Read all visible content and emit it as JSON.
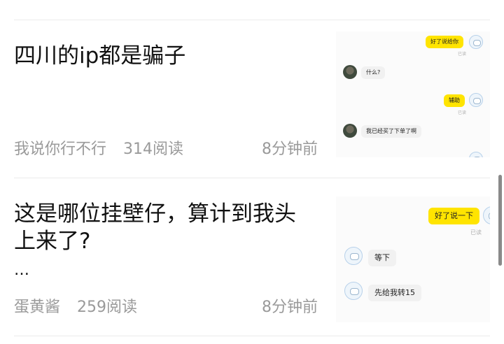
{
  "posts": [
    {
      "title": "四川的ip都是骗子",
      "author": "我说你行不行",
      "reads": "314阅读",
      "time": "8分钟前",
      "chat": {
        "top_bubble": "好了说给你",
        "top_status": "已读",
        "msg1": "什么?",
        "msg2": "辅助",
        "msg2_status": "已读",
        "msg3": "我已经买了下单了啊"
      }
    },
    {
      "title": "这是哪位挂壁仔，算计到我头上来了?",
      "ellipsis": "…",
      "author": "蛋黄酱",
      "reads": "259阅读",
      "time": "8分钟前",
      "chat": {
        "msg1": "好了说一下",
        "msg1_status": "已读",
        "msg2": "等下",
        "msg3": "先给我转15"
      }
    }
  ]
}
